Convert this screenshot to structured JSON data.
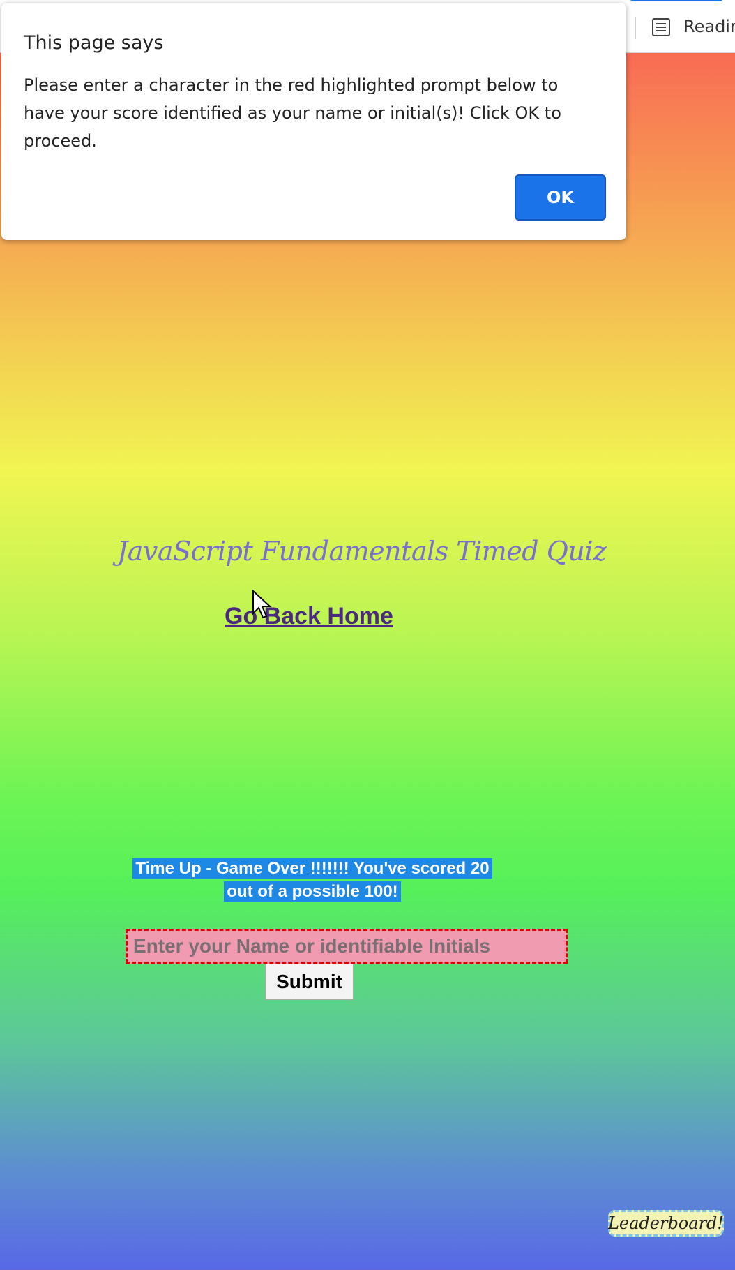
{
  "browser": {
    "reading_list_label": "Readin"
  },
  "dialog": {
    "title": "This page says",
    "message": "Please enter a character in the red highlighted prompt below to have your score identified as your name or initial(s)! Click OK to proceed.",
    "ok_label": "OK"
  },
  "page": {
    "title": "JavaScript Fundamentals Timed Quiz",
    "go_home_label": "Go Back Home",
    "score_line1": "Time Up - Game Over !!!!!!! You've scored 20",
    "score_line2": "out of a possible 100!",
    "name_placeholder": "Enter your Name or identifiable Initials",
    "submit_label": "Submit",
    "leaderboard_label": "Leaderboard!"
  },
  "colors": {
    "accent": "#1a73e8",
    "input_border": "#e00000",
    "input_bg": "#f19bb0"
  },
  "icons": {
    "reading_list": "reading-list-icon",
    "cursor": "mouse-pointer-icon"
  }
}
